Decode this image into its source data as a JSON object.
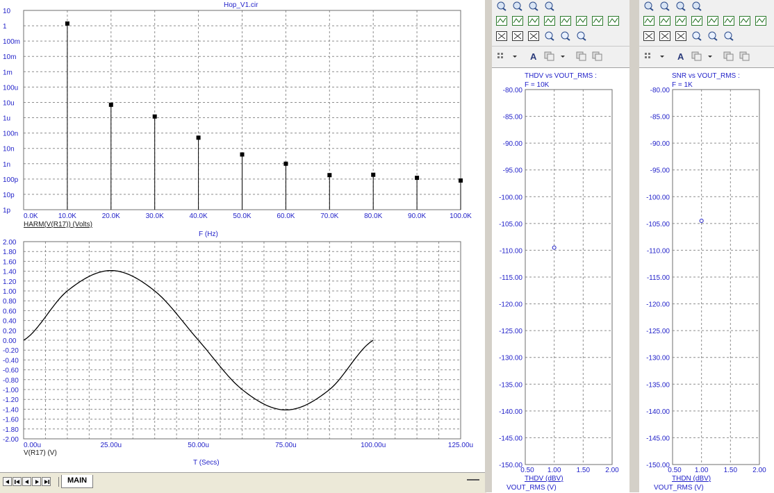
{
  "window": {
    "title": "Hop_V1.cir"
  },
  "harmonics_plot": {
    "y_tick_labels": [
      "10",
      "1",
      "100m",
      "10m",
      "1m",
      "100u",
      "10u",
      "1u",
      "100n",
      "10n",
      "1n",
      "100p",
      "10p",
      "1p"
    ],
    "x_tick_labels": [
      "0.0K",
      "10.0K",
      "20.0K",
      "30.0K",
      "40.0K",
      "50.0K",
      "60.0K",
      "70.0K",
      "80.0K",
      "90.0K",
      "100.0K"
    ],
    "trace_label": "HARM(V(R17)) (Volts)",
    "x_label": "F (Hz)"
  },
  "time_plot": {
    "y_tick_labels": [
      "2.00",
      "1.80",
      "1.60",
      "1.40",
      "1.20",
      "1.00",
      "0.80",
      "0.60",
      "0.40",
      "0.20",
      "0.00",
      "-0.20",
      "-0.40",
      "-0.60",
      "-0.80",
      "-1.00",
      "-1.20",
      "-1.40",
      "-1.60",
      "-1.80",
      "-2.00"
    ],
    "x_tick_labels": [
      "0.00u",
      "25.00u",
      "50.00u",
      "75.00u",
      "100.00u",
      "125.00u"
    ],
    "trace_label": "V(R17) (V)",
    "x_label": "T (Secs)"
  },
  "thd_panel": {
    "title": "THDV vs VOUT_RMS :",
    "subtitle": "F = 10K",
    "y_tick_labels": [
      "-80.00",
      "-85.00",
      "-90.00",
      "-95.00",
      "-100.00",
      "-105.00",
      "-110.00",
      "-115.00",
      "-120.00",
      "-125.00",
      "-130.00",
      "-135.00",
      "-140.00",
      "-145.00",
      "-150.00"
    ],
    "x_tick_labels": [
      "0.50",
      "1.00",
      "1.50",
      "2.00"
    ],
    "y_label": "THDV (dBV)",
    "x_label": "VOUT_RMS (V)"
  },
  "snr_panel": {
    "title": "SNR vs VOUT_RMS :",
    "subtitle": "F = 1K",
    "y_tick_labels": [
      "-80.00",
      "-85.00",
      "-90.00",
      "-95.00",
      "-100.00",
      "-105.00",
      "-110.00",
      "-115.00",
      "-120.00",
      "-125.00",
      "-130.00",
      "-135.00",
      "-140.00",
      "-145.00",
      "-150.00"
    ],
    "x_tick_labels": [
      "0.50",
      "1.00",
      "1.50",
      "2.00"
    ],
    "y_label": "THDN (dBV)",
    "x_label": "VOUT_RMS (V)"
  },
  "tabs": {
    "active": "MAIN"
  },
  "colors": {
    "axis_text": "#1f1fc8",
    "trace": "#000000",
    "grid": "#8c8c8c",
    "panel_bg": "#d4d0c8"
  },
  "chart_data": [
    {
      "type": "bar",
      "title": "Hop_V1.cir",
      "xlabel": "F (Hz)",
      "ylabel": "HARM(V(R17)) (Volts)",
      "y_scale": "log",
      "ylim": [
        1e-12,
        10
      ],
      "xlim": [
        0,
        100000
      ],
      "x": [
        10000,
        20000,
        30000,
        40000,
        50000,
        60000,
        70000,
        80000,
        90000,
        100000
      ],
      "values": [
        1.4,
        7e-06,
        1.2e-06,
        5e-08,
        4e-09,
        1e-09,
        1.8e-10,
        1.9e-10,
        1.2e-10,
        8e-11
      ]
    },
    {
      "type": "line",
      "xlabel": "T (Secs)",
      "ylabel": "V(R17) (V)",
      "xlim": [
        0,
        125
      ],
      "ylim": [
        -2,
        2
      ],
      "x_unit": "u",
      "x": [
        0,
        12.5,
        25,
        37.5,
        50,
        62.5,
        75,
        87.5,
        100
      ],
      "values": [
        0,
        1.0,
        1.414,
        1.0,
        0,
        -1.0,
        -1.414,
        -1.0,
        0
      ]
    },
    {
      "type": "scatter",
      "title": "THDV vs VOUT_RMS :",
      "xlabel": "VOUT_RMS (V)",
      "ylabel": "THDV (dBV)",
      "xlim": [
        0.5,
        2.0
      ],
      "ylim": [
        -150,
        -80
      ],
      "x": [
        1.0
      ],
      "values": [
        -109.5
      ]
    },
    {
      "type": "scatter",
      "title": "SNR vs VOUT_RMS :",
      "xlabel": "VOUT_RMS (V)",
      "ylabel": "THDN (dBV)",
      "xlim": [
        0.5,
        2.0
      ],
      "ylim": [
        -150,
        -80
      ],
      "x": [
        1.0
      ],
      "values": [
        -104.5
      ]
    }
  ]
}
